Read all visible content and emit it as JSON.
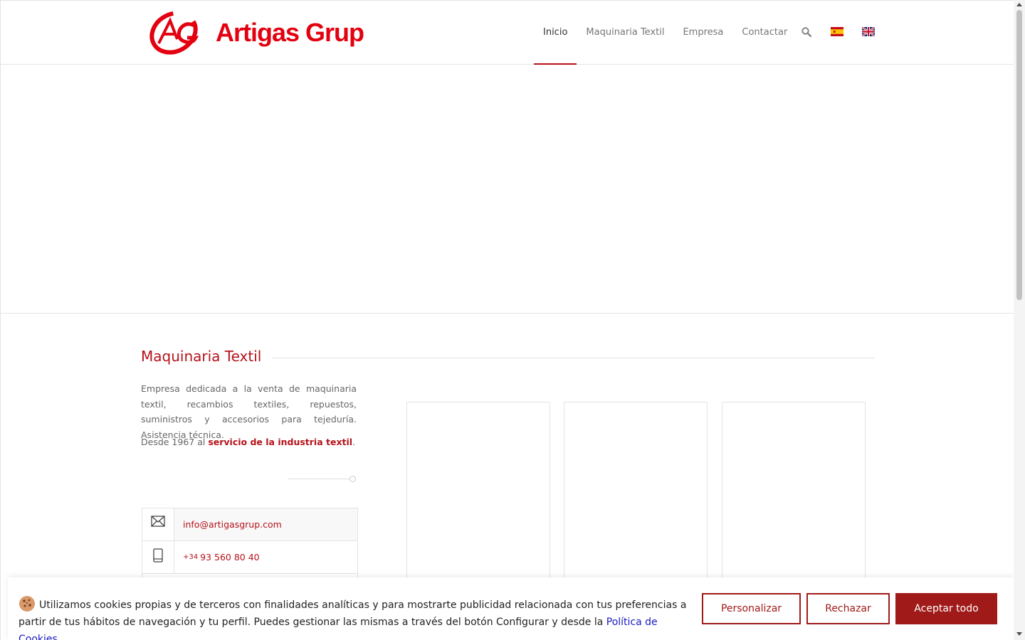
{
  "brand": {
    "name": "Artigas Grup",
    "color": "#e3000f",
    "accent": "#b5121b"
  },
  "nav": {
    "items": [
      {
        "label": "Inicio",
        "active": true
      },
      {
        "label": "Maquinaria Textil",
        "active": false
      },
      {
        "label": "Empresa",
        "active": false
      },
      {
        "label": "Contactar",
        "active": false
      }
    ],
    "search_icon": "search-icon",
    "languages": [
      "es-flag-icon",
      "uk-flag-icon"
    ]
  },
  "section": {
    "title": "Maquinaria Textil",
    "description": "Empresa dedicada a la venta de maquinaria textil, recambios textiles, repuestos, suministros y accesorios para tejeduría. Asistencia técnica.",
    "since_prefix": "Desde 1967 al ",
    "since_link": "servicio de la industria textil",
    "since_suffix": "."
  },
  "contact": {
    "email": "info@artigasgrup.com",
    "phone_prefix": "+34",
    "phone": "93 560 80 40"
  },
  "cookie": {
    "text": "Utilizamos cookies propias y de terceros con finalidades analíticas y para mostrarte publicidad relacionada con tus preferencias a partir de tus hábitos de navegación y tu perfil. Puedes gestionar las mismas a través del botón Configurar y desde la ",
    "link": "Política de Cookies",
    "suffix": ".",
    "buttons": {
      "customize": "Personalizar",
      "reject": "Rechazar",
      "accept": "Aceptar todo"
    }
  }
}
